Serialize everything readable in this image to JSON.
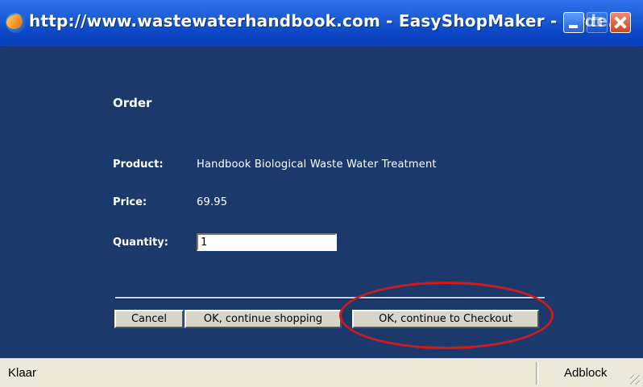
{
  "window": {
    "title": "http://www.wastewaterhandbook.com - EasyShopMaker - Orde...",
    "buttons": {
      "minimize": "minimize",
      "maximize": "maximize",
      "close": "close"
    }
  },
  "order": {
    "heading": "Order",
    "product_label": "Product:",
    "product_value": "Handbook Biological Waste Water Treatment",
    "price_label": "Price:",
    "price_value": "69.95",
    "quantity_label": "Quantity:",
    "quantity_value": "1"
  },
  "actions": {
    "cancel": "Cancel",
    "continue_shopping": "OK, continue shopping",
    "checkout": "OK, continue to Checkout"
  },
  "status_bar": {
    "text": "Klaar",
    "addon": "Adblock"
  },
  "colors": {
    "background": "#1b3a6b",
    "title_bar": "#0a46c6",
    "highlight": "#cf1b1b"
  },
  "icons": [
    "firefox-icon",
    "minimize-icon",
    "maximize-icon",
    "close-icon",
    "resize-grip-icon"
  ]
}
